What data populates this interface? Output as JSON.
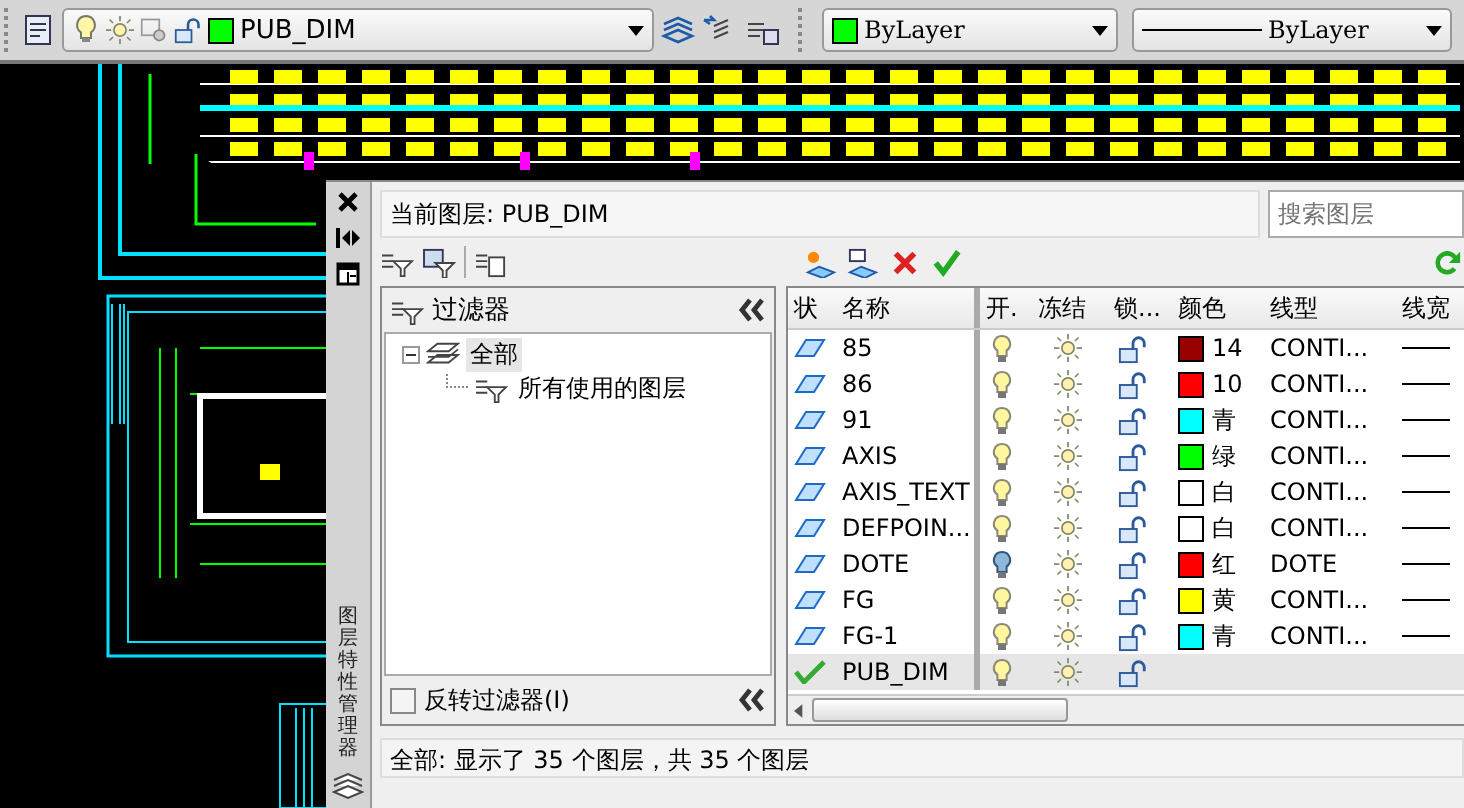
{
  "toolbar": {
    "layer_dropdown": {
      "value": "PUB_DIM"
    },
    "color_dropdown": {
      "value": "ByLayer"
    },
    "linetype_dropdown": {
      "value": "ByLayer"
    }
  },
  "palette": {
    "title": "图层特性管理器",
    "current_layer": "当前图层: PUB_DIM",
    "search": {
      "placeholder": "搜索图层"
    },
    "filter_panel": {
      "title": "过滤器",
      "tree": [
        {
          "label": "全部",
          "selected": true,
          "expanded": true,
          "children": [
            {
              "label": "所有使用的图层",
              "selected": false
            }
          ]
        }
      ],
      "invert_filter": {
        "label": "反转过滤器(I)",
        "checked": false
      }
    },
    "layer_table": {
      "columns": [
        "状",
        "名称",
        "开.",
        "冻结",
        "锁...",
        "颜色",
        "线型",
        "线宽"
      ],
      "rows": [
        {
          "name": "85",
          "current": false,
          "on": true,
          "frozen": false,
          "locked": false,
          "color": "#990000",
          "color_name": "14",
          "linetype": "CONTI..."
        },
        {
          "name": "86",
          "current": false,
          "on": true,
          "frozen": false,
          "locked": false,
          "color": "#ff0000",
          "color_name": "10",
          "linetype": "CONTI..."
        },
        {
          "name": "91",
          "current": false,
          "on": true,
          "frozen": false,
          "locked": false,
          "color": "#00ffff",
          "color_name": "青",
          "linetype": "CONTI..."
        },
        {
          "name": "AXIS",
          "current": false,
          "on": true,
          "frozen": false,
          "locked": false,
          "color": "#00ff00",
          "color_name": "绿",
          "linetype": "CONTI..."
        },
        {
          "name": "AXIS_TEXT",
          "current": false,
          "on": true,
          "frozen": false,
          "locked": false,
          "color": "#ffffff",
          "color_name": "白",
          "linetype": "CONTI..."
        },
        {
          "name": "DEFPOIN...",
          "current": false,
          "on": true,
          "frozen": false,
          "locked": false,
          "color": "#ffffff",
          "color_name": "白",
          "linetype": "CONTI..."
        },
        {
          "name": "DOTE",
          "current": false,
          "on": false,
          "frozen": false,
          "locked": false,
          "color": "#ff0000",
          "color_name": "红",
          "linetype": "DOTE"
        },
        {
          "name": "FG",
          "current": false,
          "on": true,
          "frozen": false,
          "locked": false,
          "color": "#ffff00",
          "color_name": "黄",
          "linetype": "CONTI..."
        },
        {
          "name": "FG-1",
          "current": false,
          "on": true,
          "frozen": false,
          "locked": false,
          "color": "#00ffff",
          "color_name": "青",
          "linetype": "CONTI..."
        },
        {
          "name": "PUB_DIM",
          "current": true,
          "on": true,
          "frozen": false,
          "locked": false
        }
      ]
    },
    "status_bar": "全部: 显示了 35 个图层，共 35 个图层"
  }
}
